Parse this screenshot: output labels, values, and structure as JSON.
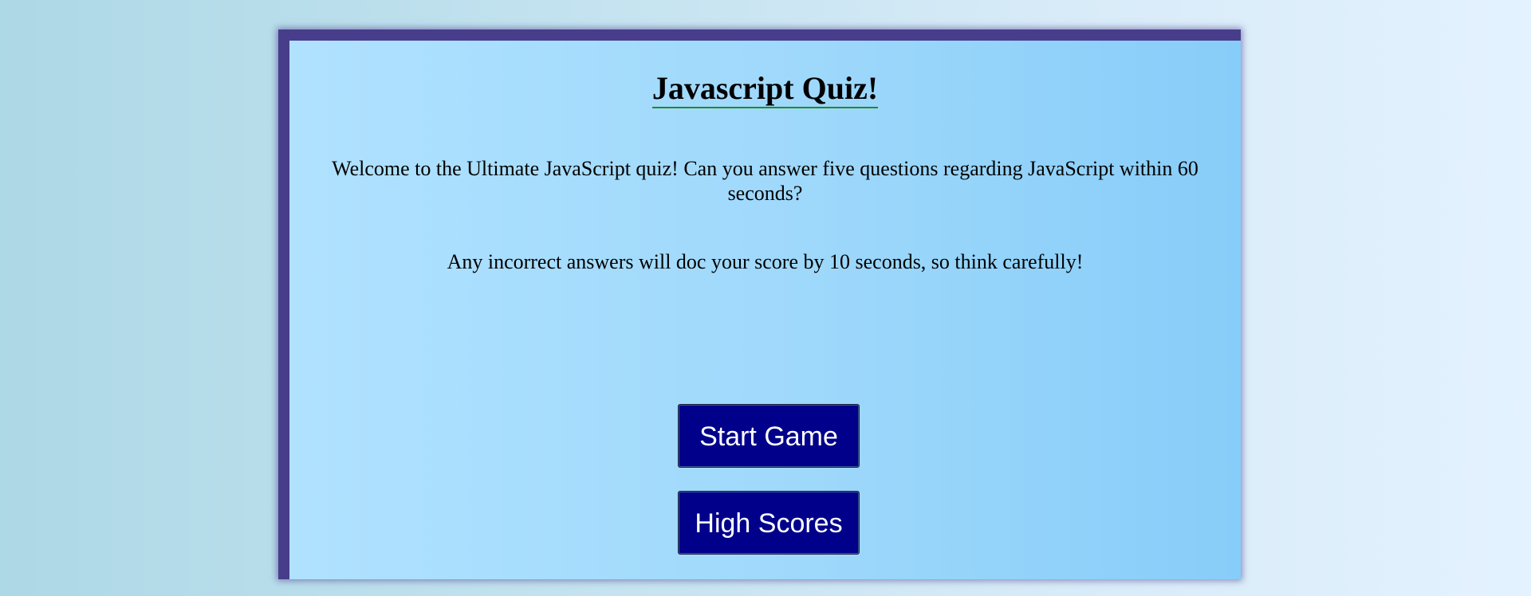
{
  "quiz": {
    "title": "Javascript Quiz!",
    "intro_paragraph_1": "Welcome to the Ultimate JavaScript quiz! Can you answer five questions regarding JavaScript within 60 seconds?",
    "intro_paragraph_2": "Any incorrect answers will doc your score by 10 seconds, so think carefully!",
    "start_button_label": "Start Game",
    "high_scores_button_label": "High Scores"
  },
  "colors": {
    "card_border": "#483d8b",
    "button_background": "#00008b",
    "title_underline": "#228b22"
  }
}
